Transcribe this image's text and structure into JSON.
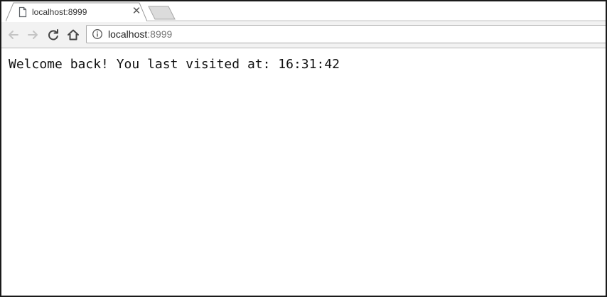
{
  "browser": {
    "tab": {
      "title": "localhost:8999",
      "close_glyph": "✕",
      "favicon": "page-icon"
    },
    "toolbar": {
      "back_icon": "back-arrow-icon",
      "forward_icon": "forward-arrow-icon",
      "reload_icon": "reload-icon",
      "home_icon": "home-icon"
    },
    "omnibox": {
      "info_icon": "info-icon",
      "url_host": "localhost",
      "url_port": ":8999"
    }
  },
  "page": {
    "message_prefix": "Welcome back! You last visited at: ",
    "last_visited_time": "16:31:42"
  }
}
